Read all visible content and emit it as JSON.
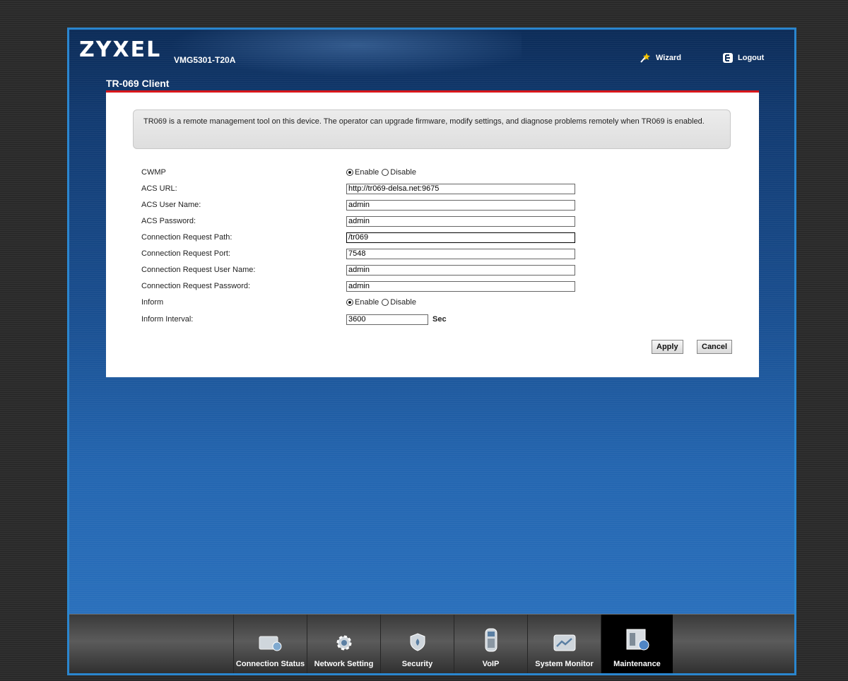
{
  "header": {
    "logo": "ZYXEL",
    "model": "VMG5301-T20A",
    "wizard_label": "Wizard",
    "logout_label": "Logout"
  },
  "page_title": "TR-069 Client",
  "info_text": "TR069 is a remote management tool on this device. The operator can upgrade firmware, modify settings, and diagnose problems remotely when TR069 is enabled.",
  "form": {
    "cwmp_label": "CWMP",
    "cwmp_enable": "Enable",
    "cwmp_disable": "Disable",
    "cwmp_value": "Enable",
    "acs_url_label": "ACS URL:",
    "acs_url_value": "http://tr069-delsa.net:9675",
    "acs_user_label": "ACS User Name:",
    "acs_user_value": "admin",
    "acs_password_label": "ACS Password:",
    "acs_password_value": "admin",
    "conn_path_label": "Connection Request Path:",
    "conn_path_value": "/tr069",
    "conn_port_label": "Connection Request Port:",
    "conn_port_value": "7548",
    "conn_user_label": "Connection Request User Name:",
    "conn_user_value": "admin",
    "conn_password_label": "Connection Request Password:",
    "conn_password_value": "admin",
    "inform_label": "Inform",
    "inform_enable": "Enable",
    "inform_disable": "Disable",
    "inform_value": "Enable",
    "inform_interval_label": "Inform Interval:",
    "inform_interval_value": "3600",
    "inform_interval_unit": "Sec"
  },
  "buttons": {
    "apply": "Apply",
    "cancel": "Cancel"
  },
  "nav": [
    {
      "label": "Connection Status",
      "icon": "connection-status-icon"
    },
    {
      "label": "Network Setting",
      "icon": "gear-icon"
    },
    {
      "label": "Security",
      "icon": "shield-icon"
    },
    {
      "label": "VoIP",
      "icon": "phone-icon"
    },
    {
      "label": "System Monitor",
      "icon": "monitor-chart-icon"
    },
    {
      "label": "Maintenance",
      "icon": "maintenance-icon",
      "active": true
    }
  ],
  "colors": {
    "accent_red": "#d8161b",
    "frame_blue": "#2a86cf"
  }
}
